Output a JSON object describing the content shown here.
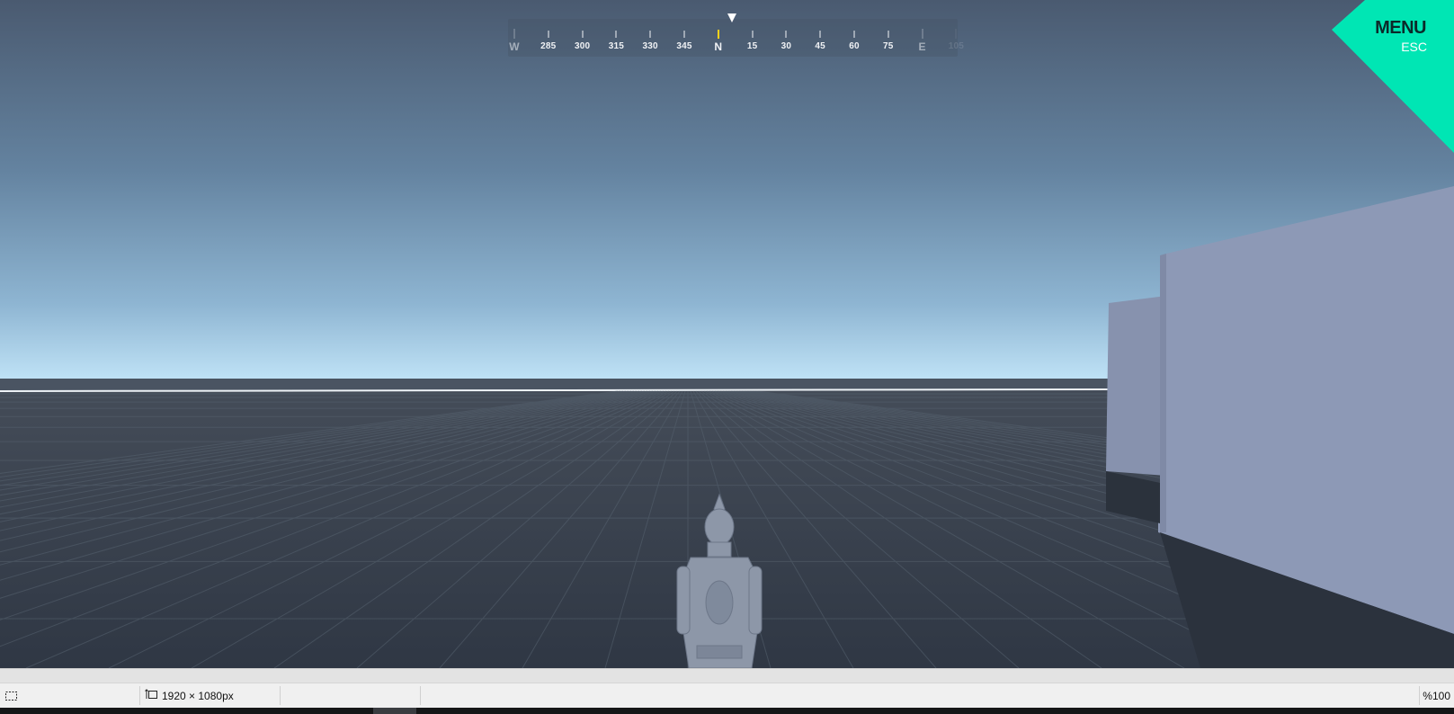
{
  "game": {
    "scene": "third-person-sandbox",
    "colors": {
      "sky_top": "#4c5d74",
      "sky_horizon": "#bcdff3",
      "ground": "#3a4350",
      "grid_line": "#4f5b6a",
      "block": "#8b97b4",
      "character": "#8d97a8",
      "menu_accent": "#00e6b4"
    }
  },
  "compass": {
    "heading_label": "N",
    "pointer_icon": "triangle-down-icon",
    "marks": [
      {
        "label": "W",
        "cardinal": true,
        "dim": true
      },
      {
        "label": "285"
      },
      {
        "label": "300"
      },
      {
        "label": "315"
      },
      {
        "label": "330"
      },
      {
        "label": "345"
      },
      {
        "label": "N",
        "cardinal": true,
        "active": true
      },
      {
        "label": "15"
      },
      {
        "label": "30"
      },
      {
        "label": "45"
      },
      {
        "label": "60"
      },
      {
        "label": "75"
      },
      {
        "label": "E",
        "cardinal": true,
        "dim": true
      },
      {
        "label": "105",
        "faint": true
      }
    ]
  },
  "menu": {
    "label": "MENU",
    "key": "ESC"
  },
  "status_bar": {
    "selection_icon": "selection-icon",
    "size_icon": "canvas-size-icon",
    "image_size": "1920 × 1080px",
    "zoom": "%100"
  }
}
